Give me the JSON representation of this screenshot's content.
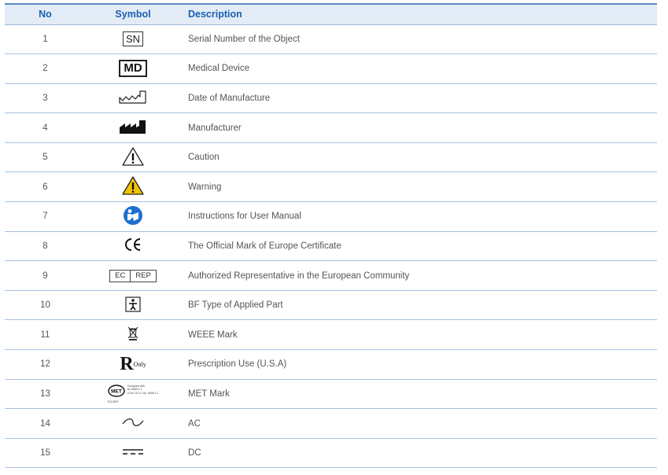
{
  "table": {
    "headers": {
      "no": "No",
      "symbol": "Symbol",
      "description": "Description"
    },
    "rows": [
      {
        "no": "1",
        "symbol_icon": "serial-number-icon",
        "symbol_text": "SN",
        "description": "Serial Number of the Object"
      },
      {
        "no": "2",
        "symbol_icon": "medical-device-icon",
        "symbol_text": "MD",
        "description": "Medical Device"
      },
      {
        "no": "3",
        "symbol_icon": "date-of-manufacture-icon",
        "description": "Date of Manufacture"
      },
      {
        "no": "4",
        "symbol_icon": "manufacturer-icon",
        "description": "Manufacturer"
      },
      {
        "no": "5",
        "symbol_icon": "caution-icon",
        "description": "Caution"
      },
      {
        "no": "6",
        "symbol_icon": "warning-icon",
        "description": "Warning"
      },
      {
        "no": "7",
        "symbol_icon": "instructions-manual-icon",
        "description": "Instructions for User Manual"
      },
      {
        "no": "8",
        "symbol_icon": "ce-mark-icon",
        "description": "The Official Mark of Europe Certificate"
      },
      {
        "no": "9",
        "symbol_icon": "ec-rep-icon",
        "symbol_text_left": "EC",
        "symbol_text_right": "REP",
        "description": "Authorized Representative in the European Community"
      },
      {
        "no": "10",
        "symbol_icon": "bf-applied-part-icon",
        "description": "BF Type of Applied Part"
      },
      {
        "no": "11",
        "symbol_icon": "weee-bin-icon",
        "description": "WEEE Mark"
      },
      {
        "no": "12",
        "symbol_icon": "rx-only-icon",
        "symbol_text": "R",
        "symbol_subtext": "Only",
        "description": "Prescription Use (U.S.A)"
      },
      {
        "no": "13",
        "symbol_icon": "met-mark-icon",
        "symbol_text": "MET",
        "symbol_note_1": "Complies with",
        "symbol_note_2": "UL 60601-1",
        "symbol_note_3": "CSA C22.2. No. 60601-1",
        "symbol_note_4": "E114597",
        "description": "MET Mark"
      },
      {
        "no": "14",
        "symbol_icon": "ac-tilde-icon",
        "description": "AC"
      },
      {
        "no": "15",
        "symbol_icon": "dc-icon",
        "description": "DC"
      }
    ]
  },
  "colors": {
    "header_text": "#1b5fb0",
    "header_bg": "#e2ebf6",
    "rule": "#a9c0e2",
    "warning_yellow": "#f5c400",
    "manual_blue": "#1e6fd0"
  }
}
